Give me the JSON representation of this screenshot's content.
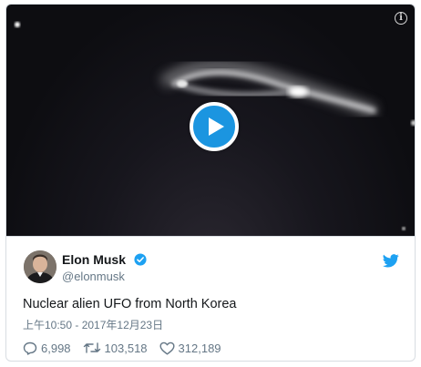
{
  "media": {
    "info_icon": "info-icon",
    "play_icon": "play-icon"
  },
  "author": {
    "name": "Elon Musk",
    "handle": "@elonmusk",
    "verified": true
  },
  "tweet": {
    "text": "Nuclear alien UFO from North Korea",
    "timestamp": "上午10:50 - 2017年12月23日"
  },
  "actions": {
    "replies": "6,998",
    "retweets": "103,518",
    "likes": "312,189"
  },
  "colors": {
    "brand": "#1da1f2",
    "play": "#1b95e0",
    "text_primary": "#14171a",
    "text_secondary": "#657786"
  }
}
